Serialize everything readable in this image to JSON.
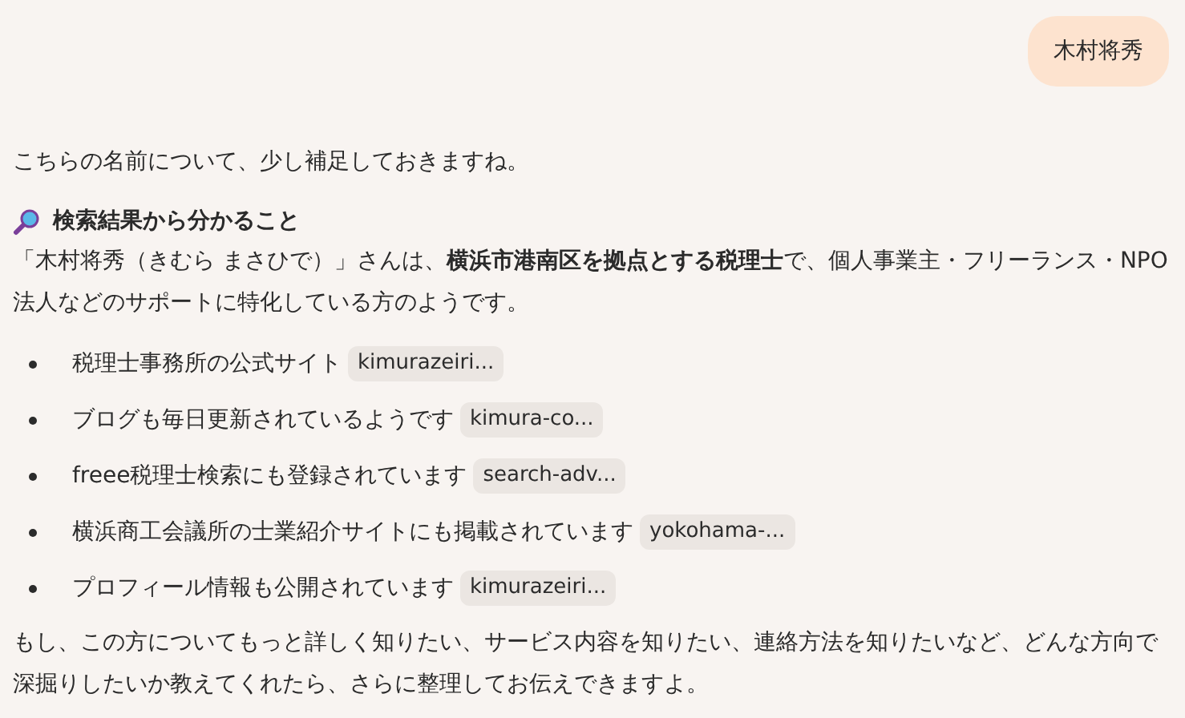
{
  "user_message": {
    "text": "木村将秀"
  },
  "reply": {
    "intro": "こちらの名前について、少し補足しておきますね。",
    "heading": "検索結果から分かること",
    "summary": "「木村将秀（きむら まさひで）」さんは、**横浜市港南区を拠点とする税理士**で、個人事業主・フリーランス・NPO法人などのサポートに特化している方のようです。",
    "sources": [
      {
        "text": "税理士事務所の公式サイト",
        "link": "kimurazeiri..."
      },
      {
        "text": "ブログも毎日更新されているようです",
        "link": "kimura-co..."
      },
      {
        "text": "freee税理士検索にも登録されています",
        "link": "search-adv..."
      },
      {
        "text": "横浜商工会議所の士業紹介サイトにも掲載されています",
        "link": "yokohama-..."
      },
      {
        "text": "プロフィール情報も公開されています",
        "link": "kimurazeiri..."
      }
    ],
    "closing": "もし、この方についてもっと詳しく知りたい、サービス内容を知りたい、連絡方法を知りたいなど、どんな方向で深掘りしたいか教えてくれたら、さらに整理してお伝えできますよ。"
  }
}
